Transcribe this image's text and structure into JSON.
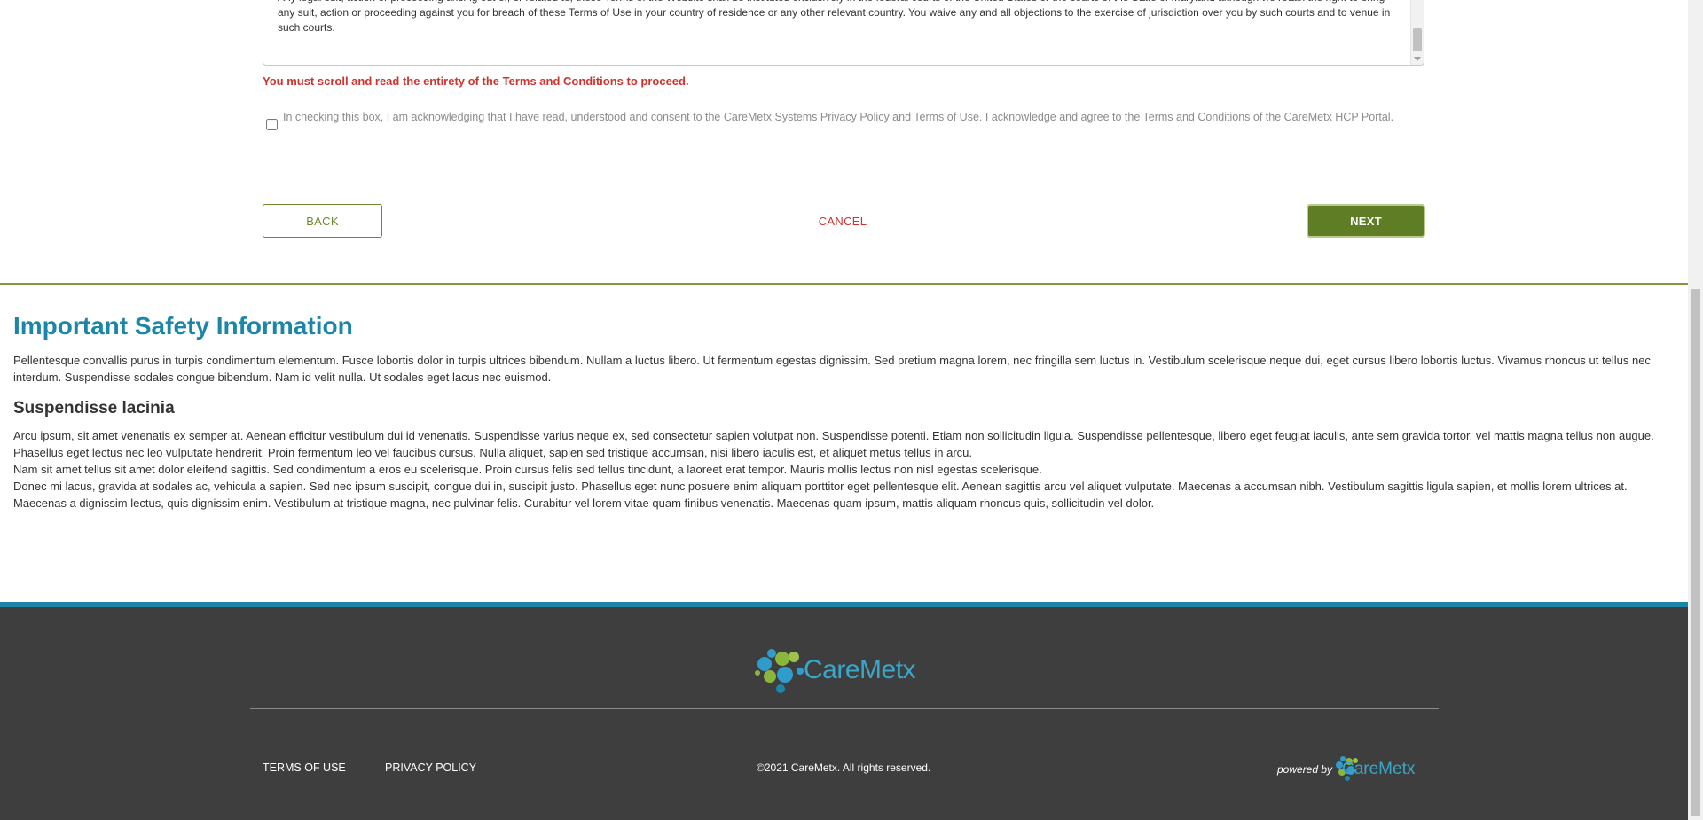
{
  "terms": {
    "text": "Any legal suit, action or proceeding arising out of, or related to, these Terms of the Website shall be instituted exclusively in the federal courts of the United States or the courts of the State of Maryland although we retain the right to bring any suit, action or proceeding against you for breach of these Terms of Use in your country of residence or any other relevant country. You waive any and all objections to the exercise of jurisdiction over you by such courts and to venue in such courts."
  },
  "warning": "You must scroll and read the entirety of the Terms and Conditions to proceed.",
  "consent": {
    "text": "In checking this box, I am acknowledging that I have read, understood and consent to the CareMetx Systems Privacy Policy and Terms of Use. I acknowledge and agree to the Terms and Conditions of the CareMetx HCP Portal.",
    "checked": false
  },
  "buttons": {
    "back": "BACK",
    "cancel": "CANCEL",
    "next": "NEXT"
  },
  "isi": {
    "title": "Important Safety Information",
    "intro": "Pellentesque convallis purus in turpis condimentum elementum. Fusce lobortis dolor in turpis ultrices bibendum. Nullam a luctus libero. Ut fermentum egestas dignissim. Sed pretium magna lorem, nec fringilla sem luctus in. Vestibulum scelerisque neque dui, eget cursus libero lobortis luctus. Vivamus rhoncus ut tellus nec interdum. Suspendisse sodales congue bibendum. Nam id velit nulla. Ut sodales eget lacus nec euismod.",
    "subtitle": "Suspendisse lacinia",
    "paragraphs": [
      "Arcu ipsum, sit amet venenatis ex semper at. Aenean efficitur vestibulum dui id venenatis. Suspendisse varius neque ex, sed consectetur sapien volutpat non. Suspendisse potenti. Etiam non sollicitudin ligula. Suspendisse pellentesque, libero eget feugiat iaculis, ante sem gravida tortor, vel mattis magna tellus non augue. Phasellus eget lectus nec leo vulputate hendrerit. Proin fermentum leo vel faucibus cursus. Nulla aliquet, sapien sed tristique accumsan, nisi libero iaculis est, et aliquet metus tellus in arcu.",
      "Nam sit amet tellus sit amet dolor eleifend sagittis. Sed condimentum a eros eu scelerisque. Proin cursus felis sed tellus tincidunt, a laoreet erat tempor. Mauris mollis lectus non nisl egestas scelerisque.",
      "Donec mi lacus, gravida at sodales ac, vehicula a sapien. Sed nec ipsum suscipit, congue dui in, suscipit justo. Phasellus eget nunc posuere enim aliquam porttitor eget pellentesque elit. Aenean sagittis arcu vel aliquet vulputate. Maecenas a accumsan nibh. Vestibulum sagittis ligula sapien, et mollis lorem ultrices at. Maecenas a dignissim lectus, quis dignissim enim. Vestibulum at tristique magna, nec pulvinar felis. Curabitur vel lorem vitae quam finibus venenatis. Maecenas quam ipsum, mattis aliquam rhoncus quis, sollicitudin vel dolor."
    ]
  },
  "footer": {
    "logo_text": "CareMetx",
    "terms_link": "TERMS OF USE",
    "privacy_link": "PRIVACY POLICY",
    "copyright": "©2021 CareMetx. All rights reserved.",
    "powered_by": "powered by",
    "powered_logo_text": "CareMetx"
  },
  "colors": {
    "brand_green": "#5e7d25",
    "brand_blue": "#1b86a8",
    "warning_red": "#d0332f",
    "footer_bg": "#3e3e3e"
  },
  "icons": {
    "logo": "caremetx-bubbles-logo",
    "checkbox": "checkbox-unchecked"
  }
}
